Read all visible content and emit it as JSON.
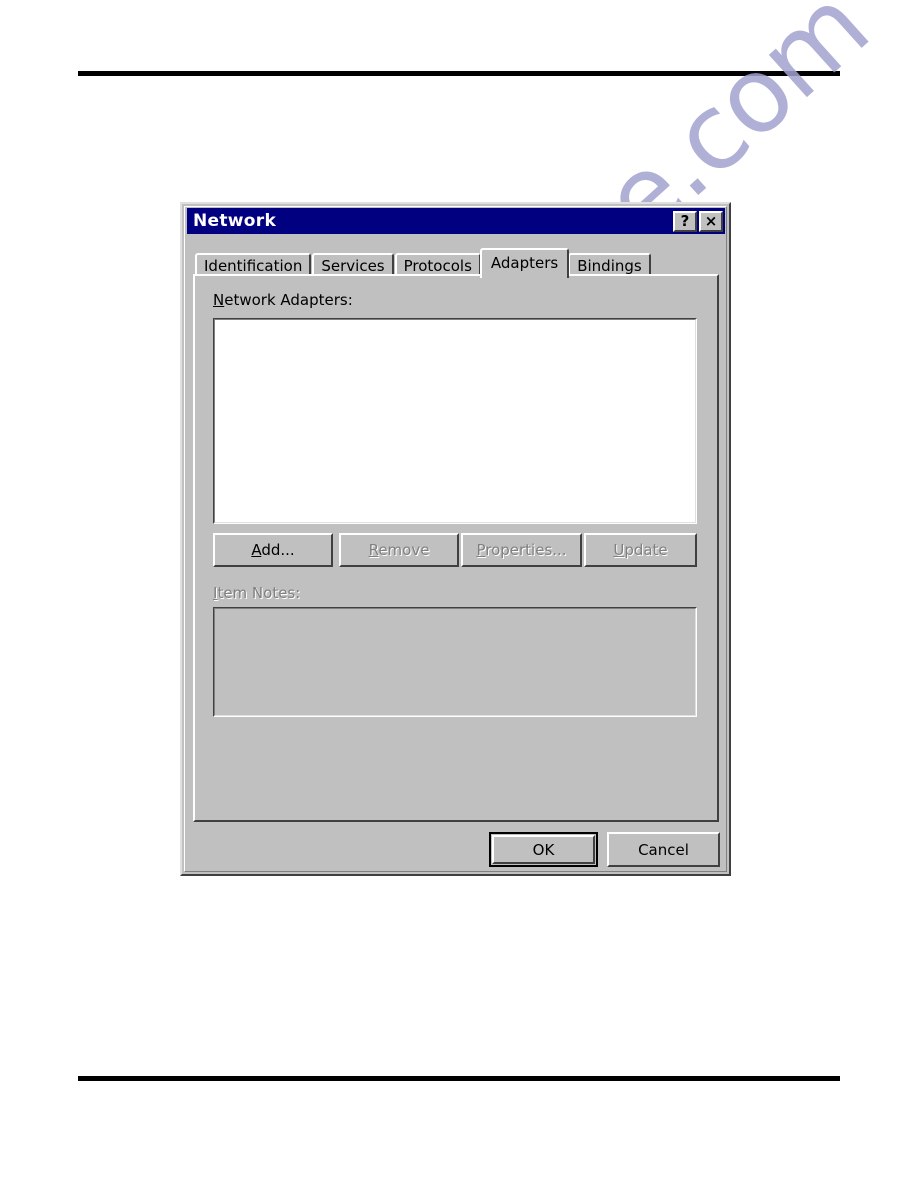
{
  "page": {
    "background": "#ffffff",
    "rule_color": "#000000",
    "watermark_text": "manualshive.com",
    "watermark_color": "#a3a3cf"
  },
  "dialog": {
    "title": "Network",
    "face_color": "#c0c0c0",
    "titlebar_color": "#000080",
    "titlebar_text_color": "#ffffff",
    "buttons": {
      "help": "?",
      "close": "×"
    },
    "tabs": [
      {
        "label": "Identification",
        "active": false
      },
      {
        "label": "Services",
        "active": false
      },
      {
        "label": "Protocols",
        "active": false
      },
      {
        "label": "Adapters",
        "active": true
      },
      {
        "label": "Bindings",
        "active": false
      }
    ],
    "adapters_tab": {
      "list_label_accel": "N",
      "list_label_rest": "etwork Adapters:",
      "list_items": [],
      "action_buttons": [
        {
          "label_accel": "A",
          "label_rest": "dd...",
          "enabled": true
        },
        {
          "label_accel": "R",
          "label_rest": "emove",
          "enabled": false
        },
        {
          "label_accel": "P",
          "label_rest": "roperties...",
          "enabled": false
        },
        {
          "label_accel": "U",
          "label_rest": "pdate",
          "enabled": false
        }
      ],
      "notes_label_accel": "I",
      "notes_label_rest": "tem Notes:",
      "notes_label_enabled": false,
      "notes_value": ""
    },
    "footer_buttons": [
      {
        "label": "OK",
        "is_default": true
      },
      {
        "label": "Cancel",
        "is_default": false
      }
    ]
  }
}
